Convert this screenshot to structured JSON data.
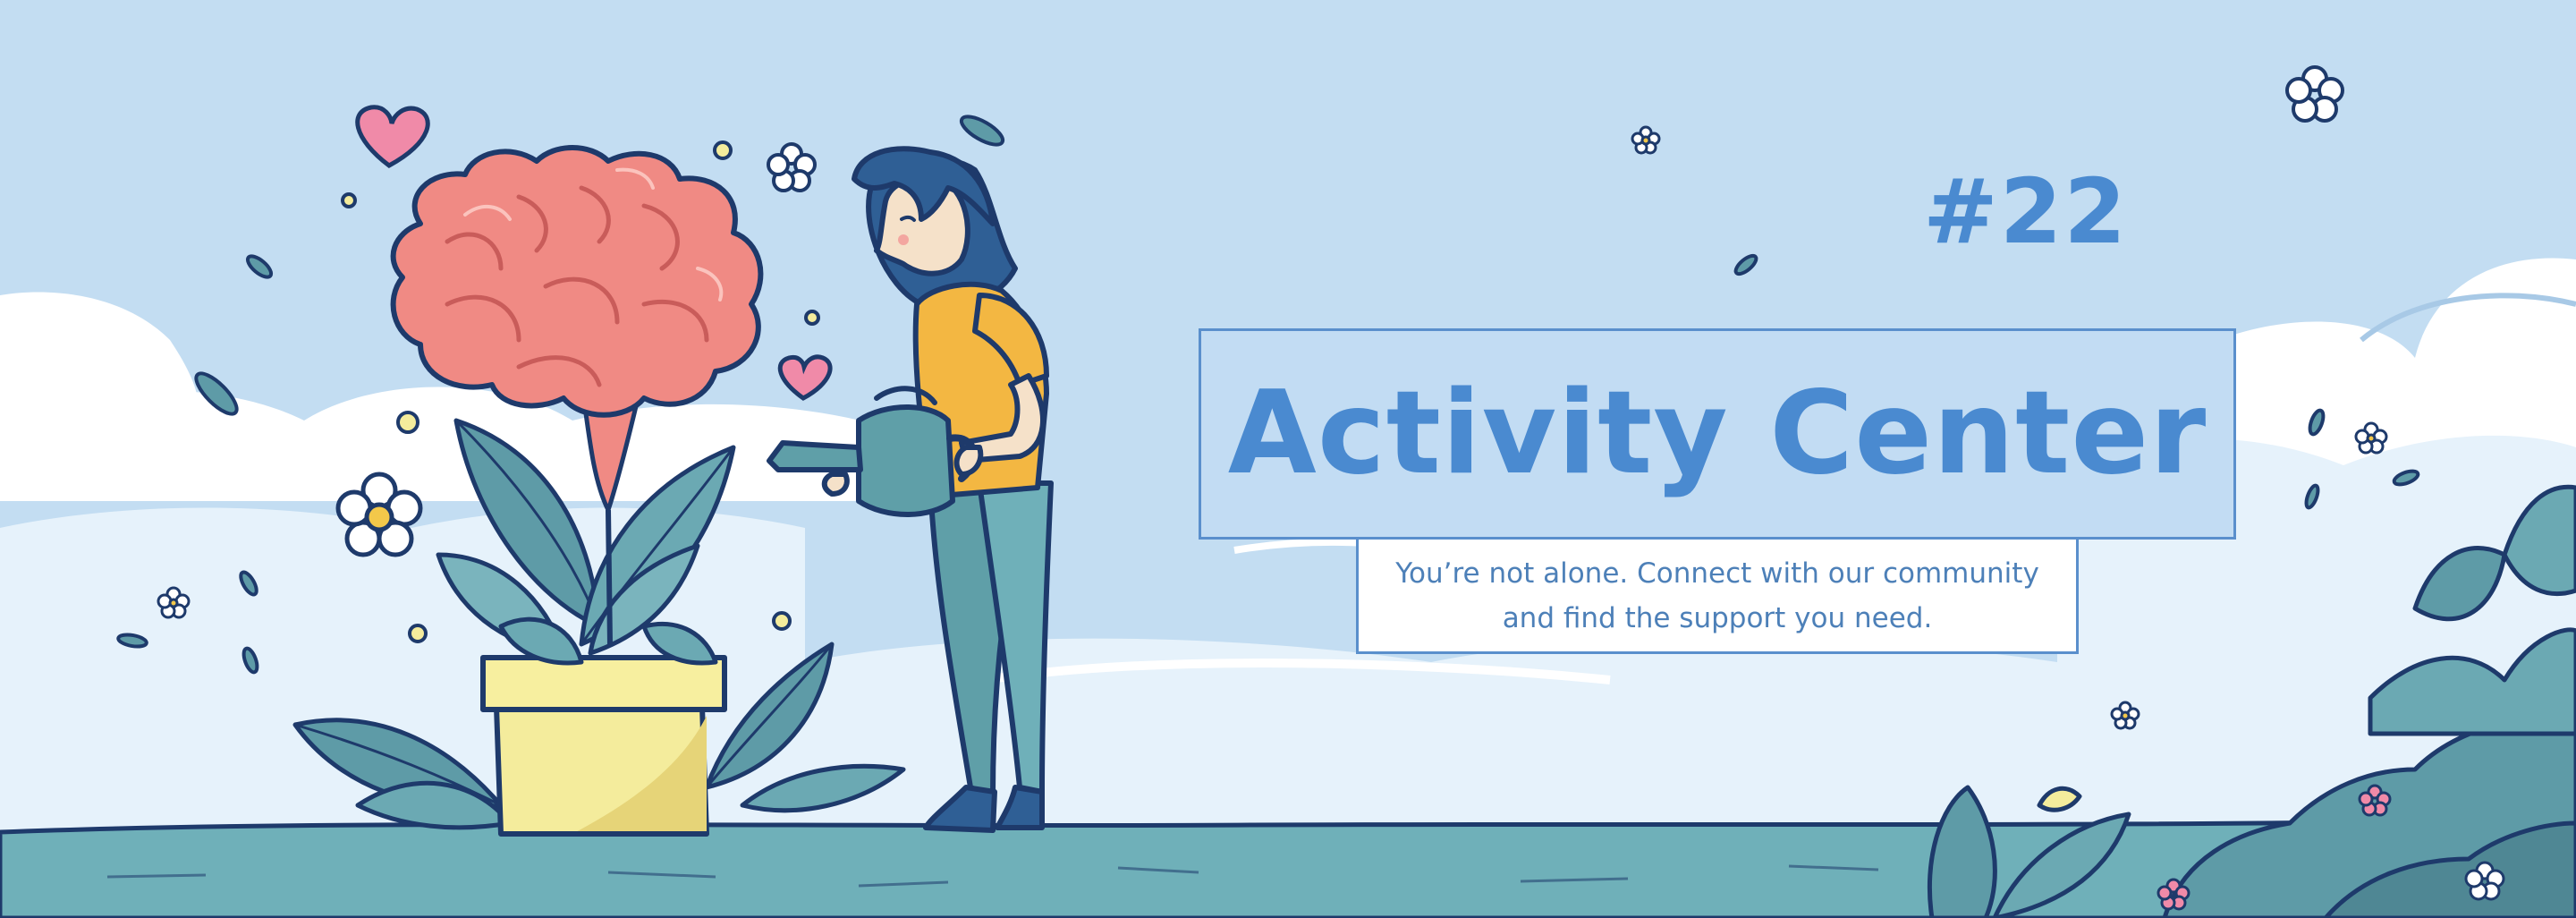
{
  "banner": {
    "episode": "#22",
    "title": "Activity Center",
    "subtitle_line_1": "You’re not alone. Connect with our community",
    "subtitle_line_2": "and find the support you need."
  },
  "colors": {
    "sky": "#c3ddf2",
    "cloud": "#ffffff",
    "ground": "#6fb0b9",
    "title_text": "#4a8ad0",
    "title_box": "#c2dcf3",
    "outline": "#1e3a6b",
    "brain": "#f08a84",
    "pot": "#f4ec9c",
    "leaf": "#5e9ba7",
    "shirt": "#f3b742"
  },
  "icons": [
    "brain-plant-icon",
    "flower-pot-icon",
    "watering-can-icon",
    "heart-icon",
    "flower-icon",
    "leaf-icon",
    "cloud-icon",
    "bush-icon"
  ]
}
